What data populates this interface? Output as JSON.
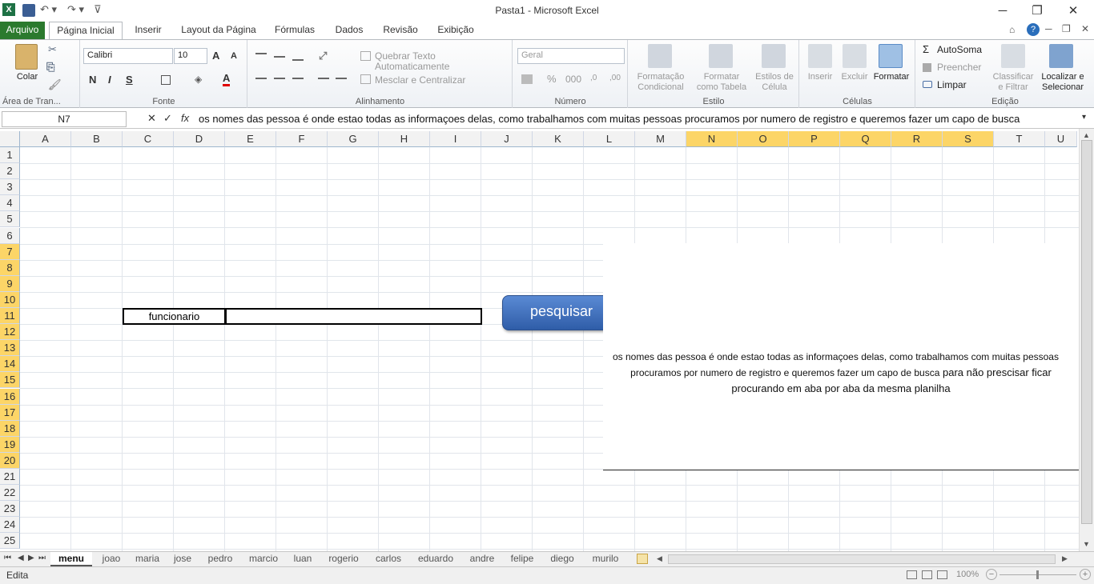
{
  "window": {
    "title": "Pasta1  -  Microsoft Excel"
  },
  "ribbon_tabs": {
    "file": "Arquivo",
    "home": "Página Inicial",
    "insert": "Inserir",
    "layout": "Layout da Página",
    "formulas": "Fórmulas",
    "data": "Dados",
    "review": "Revisão",
    "view": "Exibição"
  },
  "clipboard": {
    "paste": "Colar",
    "group": "Área de Tran..."
  },
  "font": {
    "name": "Calibri",
    "size": "10",
    "bold": "N",
    "italic": "I",
    "underline": "S",
    "grow": "A",
    "shrink": "A",
    "color_letter": "A",
    "group": "Fonte"
  },
  "alignment": {
    "wrap": "Quebrar Texto Automaticamente",
    "merge": "Mesclar e Centralizar",
    "group": "Alinhamento"
  },
  "number": {
    "format": "Geral",
    "percent": "%",
    "thousands": "000",
    "group": "Número"
  },
  "styles": {
    "conditional1": "Formatação",
    "conditional2": "Condicional",
    "table1": "Formatar",
    "table2": "como Tabela",
    "cell1": "Estilos de",
    "cell2": "Célula",
    "group": "Estilo"
  },
  "cells": {
    "insert": "Inserir",
    "delete": "Excluir",
    "format": "Formatar",
    "group": "Células"
  },
  "editing": {
    "autosum": "AutoSoma",
    "fill": "Preencher",
    "clear": "Limpar",
    "sort1": "Classificar",
    "sort2": "e Filtrar",
    "find1": "Localizar e",
    "find2": "Selecionar",
    "group": "Edição"
  },
  "formula_bar": {
    "name_box": "N7",
    "fx": "fx",
    "content": "os nomes das pessoa é onde estao todas as informaçoes delas, como trabalhamos com muitas pessoas procuramos por numero de registro e queremos fazer um capo de busca"
  },
  "columns": [
    "A",
    "B",
    "C",
    "D",
    "E",
    "F",
    "G",
    "H",
    "I",
    "J",
    "K",
    "L",
    "M",
    "N",
    "O",
    "P",
    "Q",
    "R",
    "S",
    "T",
    "U"
  ],
  "rows": [
    "1",
    "2",
    "3",
    "4",
    "5",
    "6",
    "7",
    "8",
    "9",
    "10",
    "11",
    "12",
    "13",
    "14",
    "15",
    "16",
    "17",
    "18",
    "19",
    "20",
    "21",
    "22",
    "23",
    "24",
    "25"
  ],
  "cells_content": {
    "c11": "funcionario"
  },
  "button": {
    "label": "pesquisar"
  },
  "textbox": {
    "line1": "os nomes das pessoa é onde estao todas as informaçoes delas, como trabalhamos com muitas pessoas",
    "line2a": "procuramos por numero de registro e queremos fazer um capo de busca",
    "line2b": " para não prescisar ficar",
    "line3": "procurando em aba por aba da mesma planilha"
  },
  "sheets": [
    "menu",
    "joao",
    "maria",
    "jose",
    "pedro",
    "marcio",
    "luan",
    "rogerio",
    "carlos",
    "eduardo",
    "andre",
    "felipe",
    "diego",
    "murilo"
  ],
  "active_sheet": "menu",
  "status": {
    "mode": "Edita",
    "zoom": "100%"
  },
  "colors": {
    "file_tab": "#2b7a2e",
    "selected_header": "#fcd567",
    "button": "#3d6fb8"
  }
}
